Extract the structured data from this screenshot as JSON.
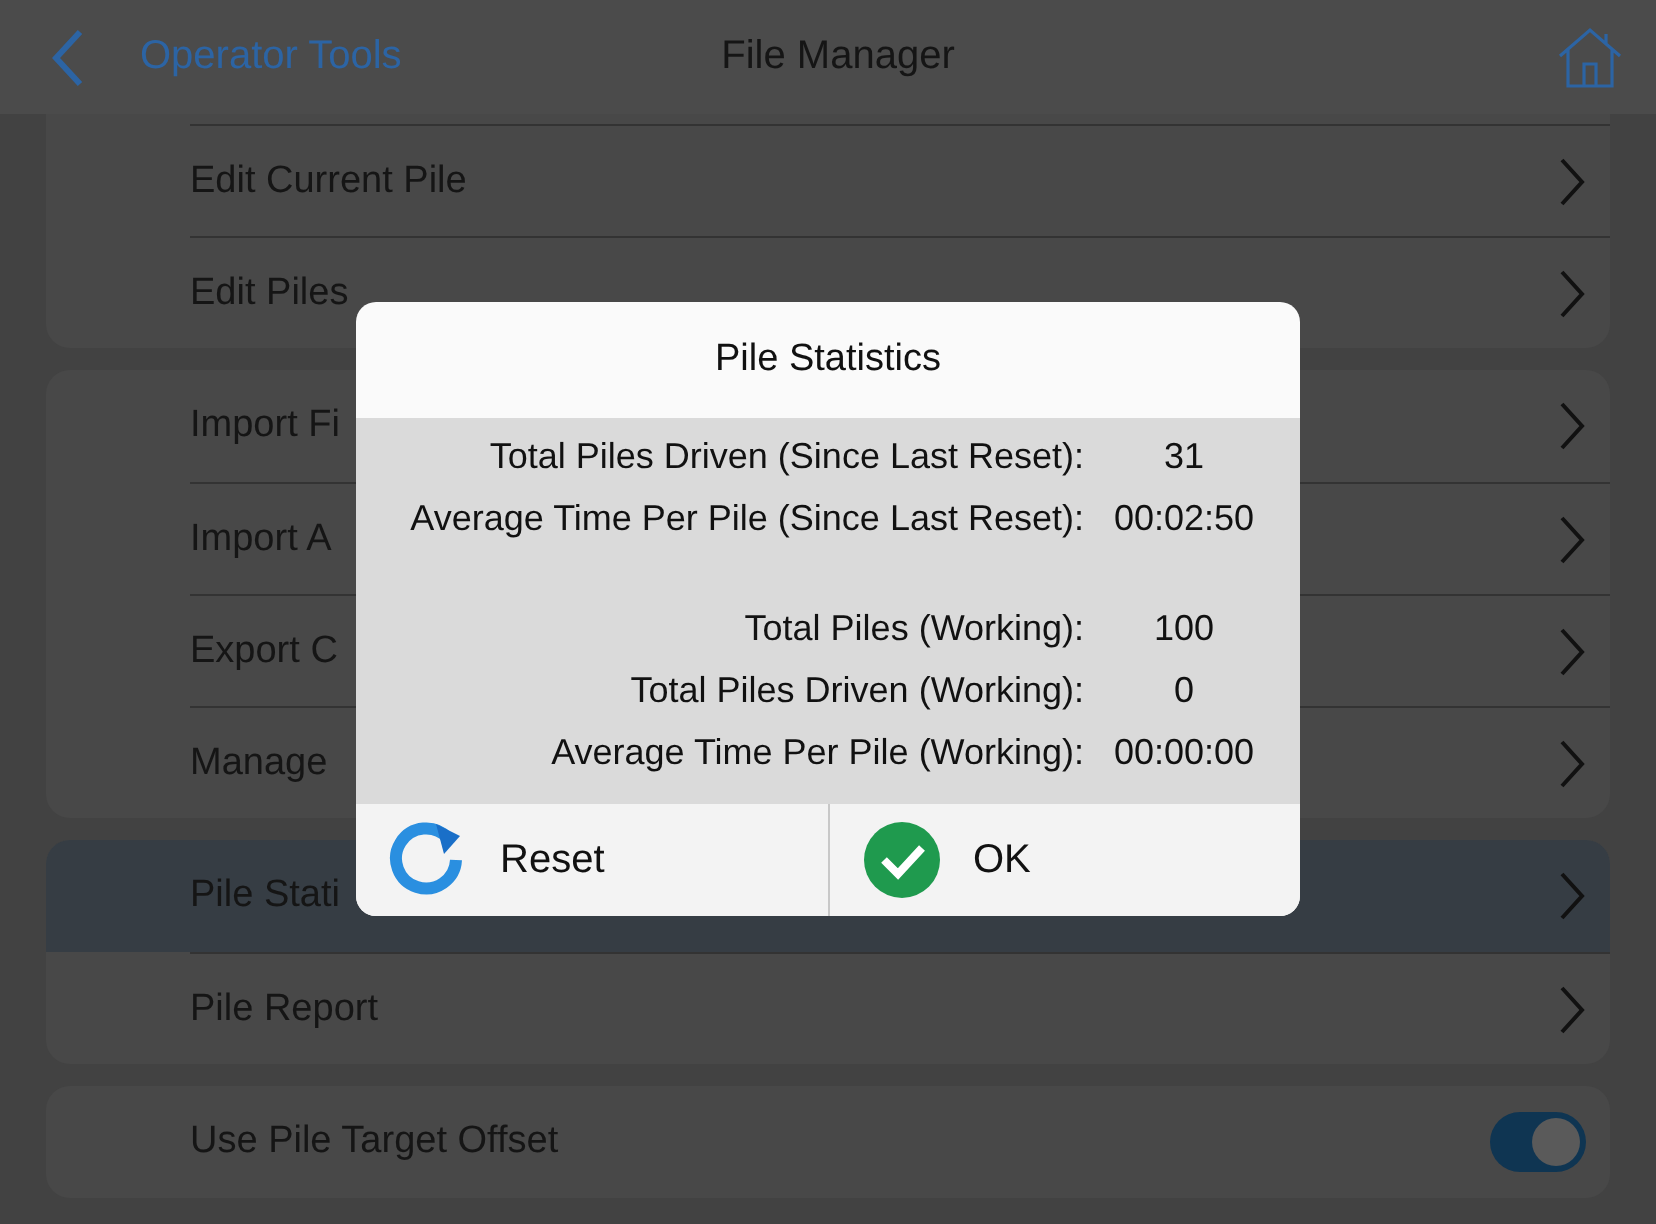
{
  "header": {
    "back_label": "Operator Tools",
    "title": "File Manager"
  },
  "groups": [
    {
      "items": [
        {
          "label": "Edit Current Pile",
          "kind": "link",
          "selected": false
        },
        {
          "label": "Edit Piles",
          "kind": "link",
          "selected": false
        }
      ]
    },
    {
      "items": [
        {
          "label": "Import Fi",
          "kind": "link",
          "selected": false
        },
        {
          "label": "Import A",
          "kind": "link",
          "selected": false
        },
        {
          "label": "Export C",
          "kind": "link",
          "selected": false
        },
        {
          "label": "Manage",
          "kind": "link",
          "selected": false
        }
      ]
    },
    {
      "items": [
        {
          "label": "Pile Stati",
          "kind": "link",
          "selected": true
        },
        {
          "label": "Pile Report",
          "kind": "link",
          "selected": false
        }
      ]
    },
    {
      "items": [
        {
          "label": "Use Pile Target Offset",
          "kind": "toggle",
          "on": true,
          "selected": false
        }
      ]
    }
  ],
  "dialog": {
    "title": "Pile Statistics",
    "sections": [
      [
        {
          "label": "Total Piles Driven (Since Last Reset):",
          "value": "31"
        },
        {
          "label": "Average Time Per Pile (Since Last Reset):",
          "value": "00:02:50"
        }
      ],
      [
        {
          "label": "Total Piles (Working):",
          "value": "100"
        },
        {
          "label": "Total Piles Driven (Working):",
          "value": "0"
        },
        {
          "label": "Average Time Per Pile (Working):",
          "value": "00:00:00"
        }
      ]
    ],
    "buttons": [
      {
        "label": "Reset",
        "kind": "reset"
      },
      {
        "label": "OK",
        "kind": "ok"
      }
    ]
  }
}
